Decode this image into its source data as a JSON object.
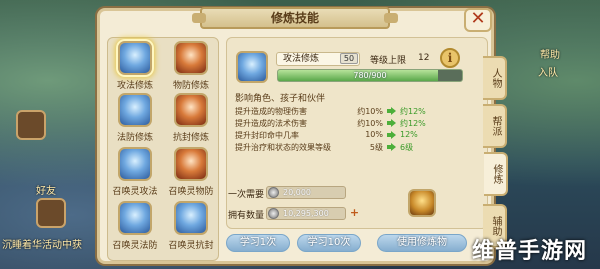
{
  "window": {
    "title": "修炼技能",
    "close_glyph": "✕"
  },
  "skills": [
    {
      "label": "攻法修炼",
      "color": "blue",
      "selected": true
    },
    {
      "label": "物防修炼",
      "color": "red",
      "selected": false
    },
    {
      "label": "法防修炼",
      "color": "blue",
      "selected": false
    },
    {
      "label": "抗封修炼",
      "color": "red",
      "selected": false
    },
    {
      "label": "召唤灵攻法",
      "color": "blue",
      "selected": false
    },
    {
      "label": "召唤灵物防",
      "color": "red",
      "selected": false
    },
    {
      "label": "召唤灵法防",
      "color": "blue",
      "selected": false
    },
    {
      "label": "召唤灵抗封",
      "color": "blue",
      "selected": false
    }
  ],
  "detail": {
    "name": "攻法修炼",
    "level": "50",
    "level_max_label": "等级上限",
    "level_max": "12",
    "progress_text": "780/900",
    "progress_fraction": 0.867,
    "description": "影响角色、孩子和伙伴",
    "stats": [
      {
        "name": "提升造成的物理伤害",
        "current": "约10%",
        "next": "约12%"
      },
      {
        "name": "提升造成的法术伤害",
        "current": "约10%",
        "next": "约12%"
      },
      {
        "name": "提升封印命中几率",
        "current": "10%",
        "next": "12%"
      },
      {
        "name": "提升治疗和状态的效果等级",
        "current": "5级",
        "next": "6级"
      }
    ]
  },
  "cost": {
    "once_label": "一次需要",
    "once_value": "20,000",
    "owned_label": "拥有数量",
    "owned_value": "10,295,300",
    "plus_glyph": "+"
  },
  "buttons": {
    "learn_1": "学习1次",
    "learn_10": "学习10次",
    "use_item": "使用修炼物"
  },
  "tabs": [
    {
      "label": "人物",
      "active": false
    },
    {
      "label": "帮派",
      "active": false
    },
    {
      "label": "修炼",
      "active": true
    },
    {
      "label": "辅助",
      "active": false
    }
  ],
  "background_texts": {
    "friend": "好友",
    "join_team": "入队",
    "bottom_left": "沉睡着华活动中获",
    "watermark": "维普手游网",
    "help": "帮助"
  },
  "info_glyph": "i"
}
